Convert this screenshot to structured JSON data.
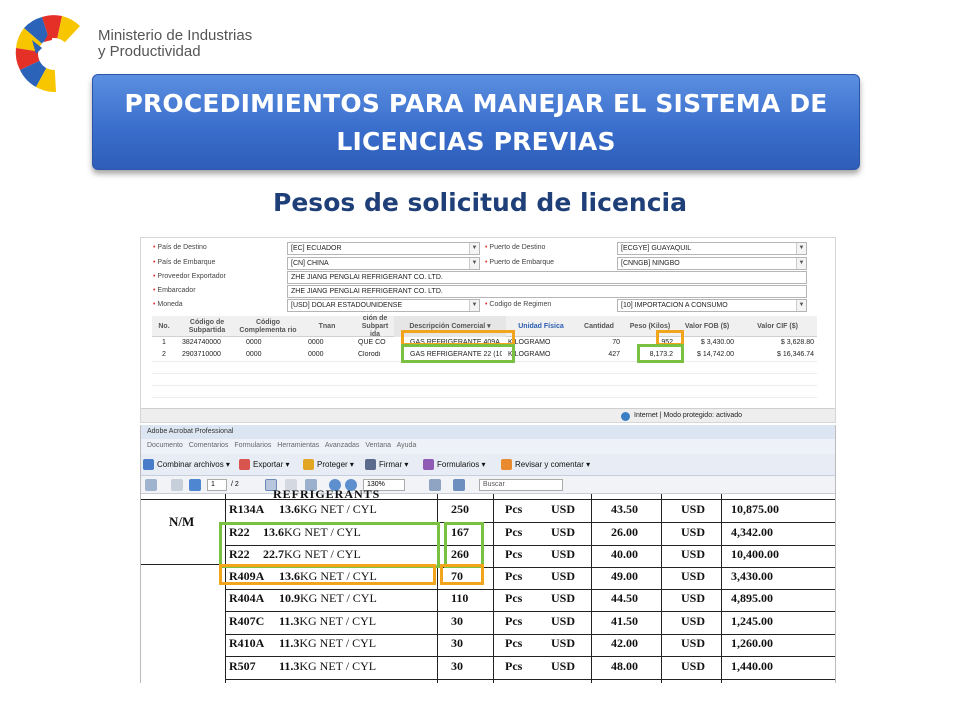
{
  "header": {
    "ministry_line1": "Ministerio de Industrias",
    "ministry_line2": "y Productividad",
    "banner_line1": "PROCEDIMIENTOS PARA MANEJAR EL SISTEMA DE",
    "banner_line2": "LICENCIAS PREVIAS",
    "subtitle": "Pesos de solicitud de licencia"
  },
  "form": {
    "fields": [
      {
        "label": "País de Destino",
        "value": "[EC] ECUADOR"
      },
      {
        "label": "País de Embarque",
        "value": "[CN] CHINA"
      },
      {
        "label": "Proveedor Exportador",
        "value": "ZHE JIANG PENGLAI REFRIGERANT CO. LTD."
      },
      {
        "label": "Embarcador",
        "value": "ZHE JIANG PENGLAI REFRIGERANT CO. LTD."
      },
      {
        "label": "Moneda",
        "value": "[USD] DOLAR ESTADOUNIDENSE"
      }
    ],
    "right_fields": [
      {
        "label": "Puerto de Destino",
        "value": "[ECGYE] GUAYAQUIL"
      },
      {
        "label": "Puerto de Embarque",
        "value": "[CNNGB] NINGBO"
      },
      {
        "label": "Codigo de Regimen",
        "value": "[10] IMPORTACION A CONSUMO"
      }
    ]
  },
  "grid": {
    "headers": [
      "No.",
      "Código de Subpartida",
      "Código Complementa rio",
      "Tnan",
      "ción de Subpart ida",
      "Descripción Comercial ▾",
      "Unidad Física",
      "Cantidad",
      "Peso (Kilos)",
      "Valor FOB ($)",
      "Valor CIF ($)"
    ],
    "rows": [
      {
        "no": "1",
        "subpartida": "3824740000",
        "complementario": "0000",
        "tnan": "0000",
        "desc_subpartida": "QUE CO",
        "descripcion": "GAS REFRIGERANTE 409A",
        "unidad": "KILOGRAMO",
        "cantidad": "70",
        "peso": "952",
        "fob": "$ 3,430.00",
        "cif": "$ 3,628.80"
      },
      {
        "no": "2",
        "subpartida": "2903710000",
        "complementario": "0000",
        "tnan": "0000",
        "desc_subpartida": "Clorodi",
        "descripcion": "GAS REFRIGERANTE 22 (10",
        "unidad": "KILOGRAMO",
        "cantidad": "427",
        "peso": "8,173.2",
        "fob": "$ 14,742.00",
        "cif": "$ 16,346.74"
      }
    ]
  },
  "ie_status": {
    "text": "Internet | Modo protegido: activado"
  },
  "acrobat": {
    "title": "Adobe Acrobat Professional",
    "menu": [
      "Documento",
      "Comentarios",
      "Formularios",
      "Herramientas",
      "Avanzadas",
      "Ventana",
      "Ayuda"
    ],
    "toolbar": [
      "Combinar archivos ▾",
      "Exportar ▾",
      "Proteger ▾",
      "Firmar ▾",
      "Formularios ▾",
      "Revisar y comentar ▾"
    ],
    "page_current": "1",
    "page_total": "/ 2",
    "zoom": "130%",
    "search_placeholder": "Buscar"
  },
  "scan_table": {
    "header_text": "REFRIGERANTS",
    "nm_label": "N/M",
    "rows": [
      {
        "code": "R134A",
        "spec": "13.6KG NET / CYL",
        "qty": "250",
        "unit": "Pcs",
        "cur1": "USD",
        "price": "43.50",
        "cur2": "USD",
        "total": "10,875.00"
      },
      {
        "code": "R22",
        "spec": "13.6KG NET / CYL",
        "qty": "167",
        "unit": "Pcs",
        "cur1": "USD",
        "price": "26.00",
        "cur2": "USD",
        "total": "4,342.00"
      },
      {
        "code": "R22",
        "spec": "22.7KG NET / CYL",
        "qty": "260",
        "unit": "Pcs",
        "cur1": "USD",
        "price": "40.00",
        "cur2": "USD",
        "total": "10,400.00"
      },
      {
        "code": "R409A",
        "spec": "13.6KG NET / CYL",
        "qty": "70",
        "unit": "Pcs",
        "cur1": "USD",
        "price": "49.00",
        "cur2": "USD",
        "total": "3,430.00"
      },
      {
        "code": "R404A",
        "spec": "10.9KG NET / CYL",
        "qty": "110",
        "unit": "Pcs",
        "cur1": "USD",
        "price": "44.50",
        "cur2": "USD",
        "total": "4,895.00"
      },
      {
        "code": "R407C",
        "spec": "11.3KG NET / CYL",
        "qty": "30",
        "unit": "Pcs",
        "cur1": "USD",
        "price": "41.50",
        "cur2": "USD",
        "total": "1,245.00"
      },
      {
        "code": "R410A",
        "spec": "11.3KG NET / CYL",
        "qty": "30",
        "unit": "Pcs",
        "cur1": "USD",
        "price": "42.00",
        "cur2": "USD",
        "total": "1,260.00"
      },
      {
        "code": "R507",
        "spec": "11.3KG NET / CYL",
        "qty": "30",
        "unit": "Pcs",
        "cur1": "USD",
        "price": "48.00",
        "cur2": "USD",
        "total": "1,440.00"
      }
    ]
  },
  "colors": {
    "banner": "#3b6fcd",
    "subtitle": "#1f3f78",
    "highlight_orange": "#f2a51c",
    "highlight_green": "#7ac142"
  }
}
